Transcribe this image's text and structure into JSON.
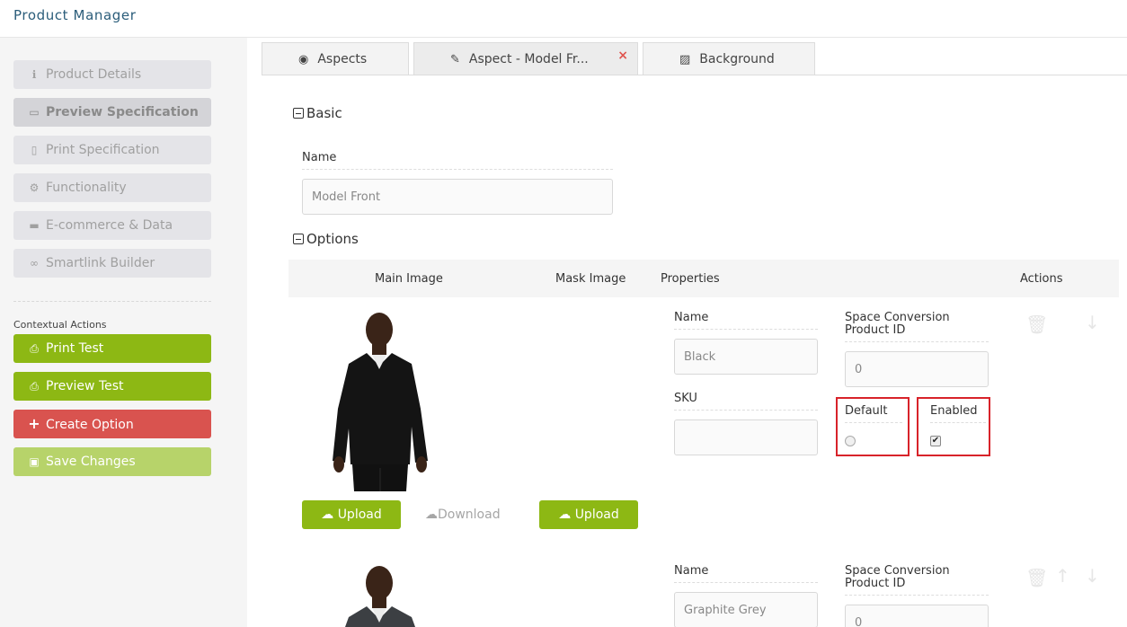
{
  "app": {
    "title": "Product Manager"
  },
  "sidebar": {
    "nav": [
      {
        "label": "Product Details",
        "icon": "info-icon"
      },
      {
        "label": "Preview Specification",
        "icon": "monitor-icon"
      },
      {
        "label": "Print Specification",
        "icon": "pdf-file-icon"
      },
      {
        "label": "Functionality",
        "icon": "gears-icon"
      },
      {
        "label": "E-commerce & Data",
        "icon": "credit-card-icon"
      },
      {
        "label": "Smartlink Builder",
        "icon": "link-icon"
      }
    ],
    "contextual_label": "Contextual Actions",
    "actions": [
      {
        "label": "Print Test",
        "icon": "printer-icon"
      },
      {
        "label": "Preview Test",
        "icon": "printer-icon"
      },
      {
        "label": "Create Option",
        "icon": "plus-icon"
      },
      {
        "label": "Save Changes",
        "icon": "floppy-icon"
      }
    ]
  },
  "tabs": [
    {
      "label": "Aspects",
      "icon": "eye-icon"
    },
    {
      "label": "Aspect - Model Fr...",
      "icon": "edit-icon",
      "close": "×"
    },
    {
      "label": "Background",
      "icon": "image-icon"
    }
  ],
  "basic": {
    "heading": "Basic",
    "name_label": "Name",
    "name_value": "Model Front"
  },
  "options": {
    "heading": "Options",
    "columns": [
      "Main Image",
      "Mask Image",
      "Properties",
      "Actions"
    ],
    "rows": [
      {
        "name_label": "Name",
        "name_value": "Black",
        "sku_label": "SKU",
        "sku_value": "",
        "space_label_1": "Space Conversion",
        "space_label_2": "Product ID",
        "space_value": "0",
        "default_label": "Default",
        "enabled_label": "Enabled",
        "default_selected": false,
        "enabled_checked": true,
        "upload_main": "Upload",
        "download": "Download",
        "upload_mask": "Upload",
        "shirt_color": "#141414"
      },
      {
        "name_label": "Name",
        "name_value": "Graphite Grey",
        "space_label_1": "Space Conversion",
        "space_label_2": "Product ID",
        "space_value": "0",
        "shirt_color": "#3c3f43"
      }
    ]
  },
  "colors": {
    "accent_green": "#8db814",
    "danger_red": "#d9534f",
    "highlight_red": "#d8232a"
  }
}
